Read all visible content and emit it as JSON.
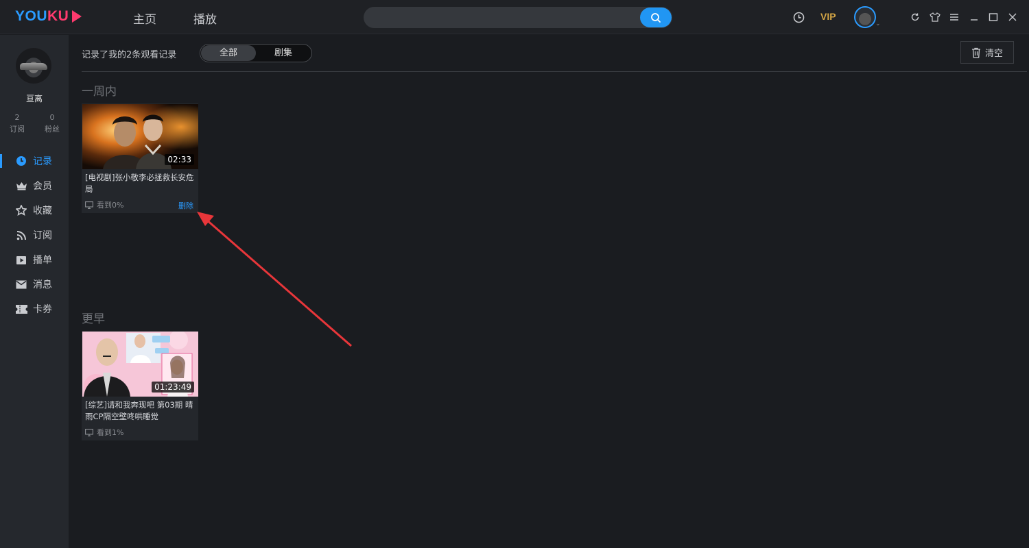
{
  "app": {
    "logo": "YOUKU",
    "nav": [
      "主页",
      "播放"
    ],
    "search": {
      "value": "",
      "placeholder": ""
    },
    "vip_label": "VIP"
  },
  "sidebar": {
    "username": "亘离",
    "stats": [
      {
        "count": "2",
        "label": "订阅"
      },
      {
        "count": "0",
        "label": "粉丝"
      }
    ],
    "menu": [
      {
        "label": "记录",
        "icon": "clock-icon",
        "active": true
      },
      {
        "label": "会员",
        "icon": "crown-icon",
        "active": false
      },
      {
        "label": "收藏",
        "icon": "star-icon",
        "active": false
      },
      {
        "label": "订阅",
        "icon": "rss-icon",
        "active": false
      },
      {
        "label": "播单",
        "icon": "playlist-icon",
        "active": false
      },
      {
        "label": "消息",
        "icon": "mail-icon",
        "active": false
      },
      {
        "label": "卡券",
        "icon": "ticket-icon",
        "active": false
      }
    ]
  },
  "main": {
    "summary": "记录了我的2条观看记录",
    "filter_tabs": [
      {
        "label": "全部",
        "selected": true
      },
      {
        "label": "剧集",
        "selected": false
      }
    ],
    "clear_label": "清空",
    "sections": [
      {
        "title": "一周内",
        "items": [
          {
            "title": "[电视剧]张小敬李必拯救长安危局",
            "duration": "02:33",
            "progress": "看到0%",
            "delete_label": "删除"
          }
        ]
      },
      {
        "title": "更早",
        "items": [
          {
            "title": "[综艺]请和我奔现吧 第03期 晴雨CP隔空壁咚哄睡觉",
            "duration": "01:23:49",
            "progress": "看到1%"
          }
        ]
      }
    ]
  },
  "colors": {
    "accent": "#2a9bff",
    "brand_pink": "#ff3a6e",
    "vip_gold": "#d3a545",
    "annotation_arrow": "#e8363a"
  }
}
